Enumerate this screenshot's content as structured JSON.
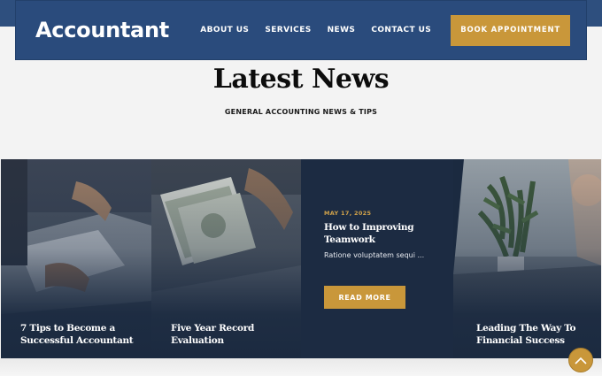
{
  "header": {
    "logo": "Accountant",
    "nav": [
      "ABOUT US",
      "SERVICES",
      "NEWS",
      "CONTACT US"
    ],
    "cta": "BOOK APPOINTMENT"
  },
  "section": {
    "title": "Latest News",
    "subtitle": "GENERAL ACCOUNTING NEWS & TIPS"
  },
  "posts": [
    {
      "title": "7 Tips to Become a Successful Accountant"
    },
    {
      "title": "Five Year Record Evaluation"
    },
    {
      "date": "MAY 17, 2025",
      "title": "How to Improving Teamwork",
      "excerpt": "Ratione voluptatem sequi ...",
      "button": "READ MORE"
    },
    {
      "title": "Leading The Way To Financial Success"
    }
  ],
  "colors": {
    "navy": "#2a4b7c",
    "dark_navy": "#1b2a40",
    "gold": "#c9973a"
  },
  "icons": {
    "scroll_top": "chevron-up-icon"
  }
}
